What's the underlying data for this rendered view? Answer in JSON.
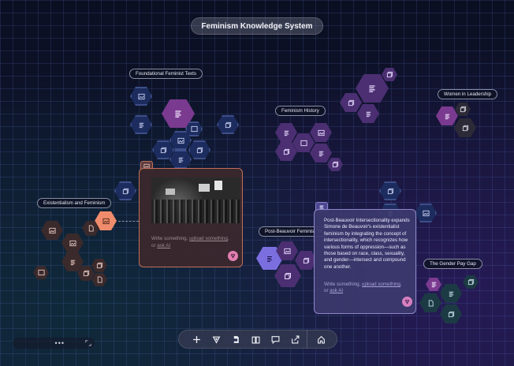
{
  "app": {
    "title": "Feminism Knowledge System"
  },
  "colors": {
    "accent_orange": "#f08c6c",
    "accent_violet": "#7b6fe0",
    "grid": "#2a3a70",
    "card_research": "#3c282c",
    "card_note": "#3c3a6e"
  },
  "topic_labels": {
    "foundational": "Foundational Feminist Texts",
    "history": "Feminism History",
    "leadership": "Women in Leadership",
    "existentialism": "Existentialism and Feminism",
    "post_beauvoir": "Post-Beauvoir Feminist Th",
    "pay_gap": "The Gender Pay Gap"
  },
  "image_card": {
    "placeholder_prefix": "Write something, ",
    "placeholder_link1": "upload something",
    "placeholder_mid": ",",
    "placeholder_or": "or ",
    "placeholder_link2": "ask AI"
  },
  "note_card": {
    "text": "Post-Beauvoir Intersectionality expands Simone de Beauvoir's existentialist feminism by integrating the concept of intersectionality, which recognizes how various forms of oppression—such as those based on race, class, sexuality, and gender—intersect and compound one another.",
    "placeholder_prefix": "Write something, ",
    "placeholder_link1": "upload something",
    "placeholder_mid": ",",
    "placeholder_or": "or ",
    "placeholder_link2": "ask AI"
  },
  "toolbar": {
    "items": [
      "add-icon",
      "ai-icon",
      "pdf-icon",
      "book-icon",
      "comment-icon",
      "share-icon",
      "home-icon"
    ]
  },
  "minimap": {
    "dots": "•••"
  }
}
